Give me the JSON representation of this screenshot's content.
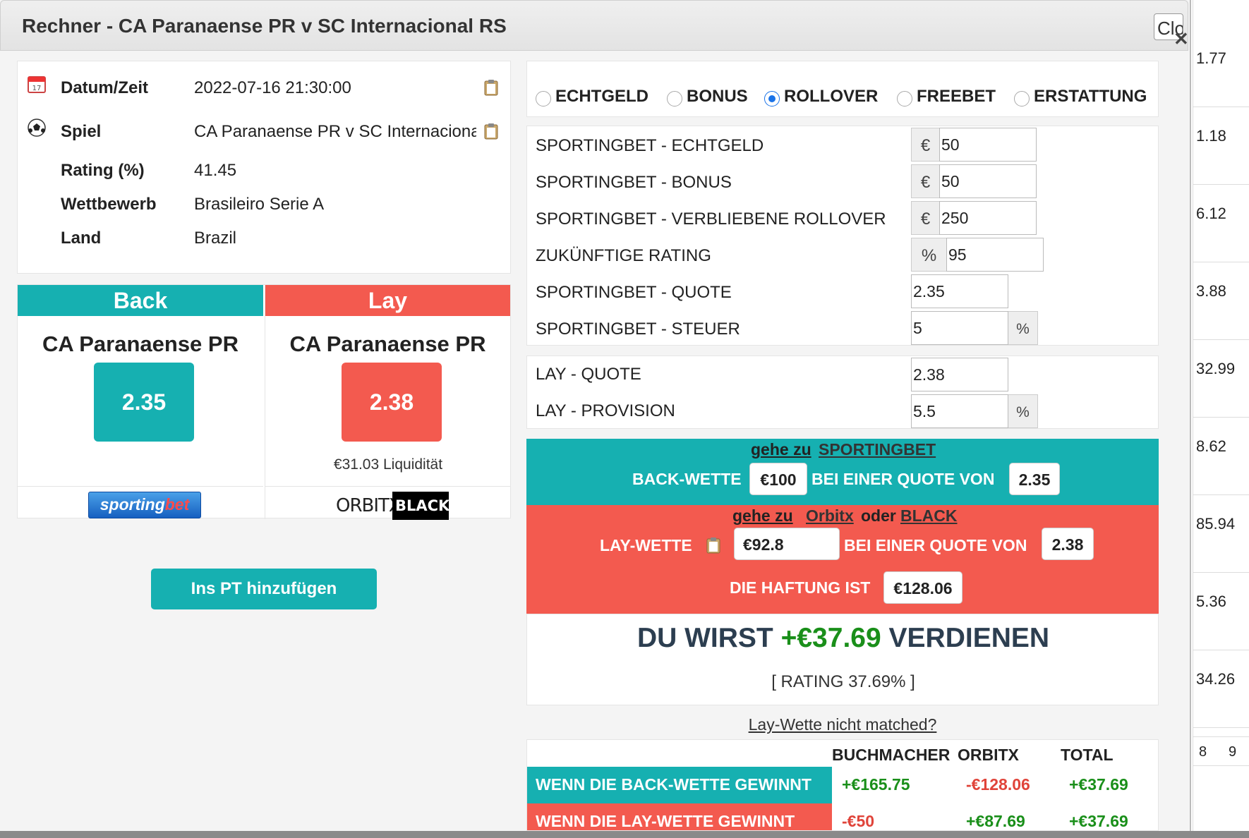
{
  "modal": {
    "title": "Rechner - CA Paranaense PR v SC Internacional RS",
    "close_label": "Close"
  },
  "info": {
    "rows": [
      {
        "icon": "calendar-icon",
        "label": "Datum/Zeit",
        "value": "2022-07-16 21:30:00",
        "copy": true
      },
      {
        "icon": "football-icon",
        "label": "Spiel",
        "value": "CA Paranaense PR v SC Internacional RS",
        "copy": true
      },
      {
        "icon": "",
        "label": "Rating (%)",
        "value": "41.45",
        "copy": false
      },
      {
        "icon": "",
        "label": "Wettbewerb",
        "value": "Brasileiro Serie A",
        "copy": false
      },
      {
        "icon": "",
        "label": "Land",
        "value": "Brazil",
        "copy": false
      }
    ]
  },
  "back_card": {
    "header": "Back",
    "team": "CA Paranaense PR",
    "odds": "2.35",
    "bookmaker_logo": "sportingbet"
  },
  "lay_card": {
    "header": "Lay",
    "team": "CA Paranaense PR",
    "odds": "2.38",
    "liquidity": "€31.03 Liquidität",
    "exchange_logo_left": "ORBITX",
    "exchange_logo_right": "BLACK"
  },
  "add_pt_label": "Ins PT hinzufügen",
  "bet_types": [
    {
      "label": "ECHTGELD",
      "checked": false
    },
    {
      "label": "BONUS",
      "checked": false
    },
    {
      "label": "ROLLOVER",
      "checked": true
    },
    {
      "label": "FREEBET",
      "checked": false
    },
    {
      "label": "ERSTATTUNG",
      "checked": false
    }
  ],
  "form": {
    "echtgeld": {
      "label": "SPORTINGBET - ECHTGELD",
      "addon": "€",
      "value": "50"
    },
    "bonus": {
      "label": "SPORTINGBET - BONUS",
      "addon": "€",
      "value": "50"
    },
    "rollover": {
      "label": "SPORTINGBET - VERBLIEBENE ROLLOVER",
      "addon": "€",
      "value": "250"
    },
    "future_rating": {
      "label": "ZUKÜNFTIGE RATING",
      "addon": "%",
      "value": "95"
    },
    "quote": {
      "label": "SPORTINGBET - QUOTE",
      "value": "2.35"
    },
    "steuer": {
      "label": "SPORTINGBET - STEUER",
      "value": "5",
      "addon": "%"
    },
    "lay_quote": {
      "label": "LAY - QUOTE",
      "value": "2.38"
    },
    "lay_provision": {
      "label": "LAY - PROVISION",
      "value": "5.5",
      "addon": "%"
    }
  },
  "back_strip": {
    "goto_prefix": "gehe zu",
    "goto_name": "SPORTINGBET",
    "label": "BACK-WETTE",
    "stake": "€100",
    "mid": "BEI EINER QUOTE VON",
    "odds": "2.35"
  },
  "lay_strip": {
    "goto_prefix": "gehe zu",
    "goto_name1": "Orbitx",
    "or": "oder",
    "goto_name2": "BLACK",
    "label": "LAY-WETTE",
    "stake": "€92.8",
    "mid": "BEI EINER QUOTE VON",
    "odds": "2.38",
    "liability_label": "DIE HAFTUNG IST",
    "liability": "€128.06"
  },
  "result": {
    "prefix": "DU WIRST",
    "amount": "+€37.69",
    "suffix": "VERDIENEN",
    "rating": "[ RATING 37.69% ]"
  },
  "unmatched_link": "Lay-Wette nicht matched?",
  "summary": {
    "headers": [
      "BUCHMACHER",
      "ORBITX",
      "TOTAL"
    ],
    "rows": [
      {
        "label": "WENN DIE BACK-WETTE GEWINNT",
        "bookmaker": "+€165.75",
        "exchange": "-€128.06",
        "total": "+€37.69"
      },
      {
        "label": "WENN DIE LAY-WETTE GEWINNT",
        "bookmaker": "-€50",
        "exchange": "+€87.69",
        "total": "+€37.69"
      }
    ]
  },
  "background_column": [
    "1.77",
    "1.18",
    "6.12",
    "3.88",
    "32.99",
    "8.62",
    "85.94",
    "5.36",
    "34.26"
  ],
  "background_pagination": [
    "8",
    "9"
  ],
  "colors": {
    "teal": "#16b0b1",
    "red": "#f35a4f",
    "positive": "#1a8f1a",
    "negative": "#e0443a"
  }
}
